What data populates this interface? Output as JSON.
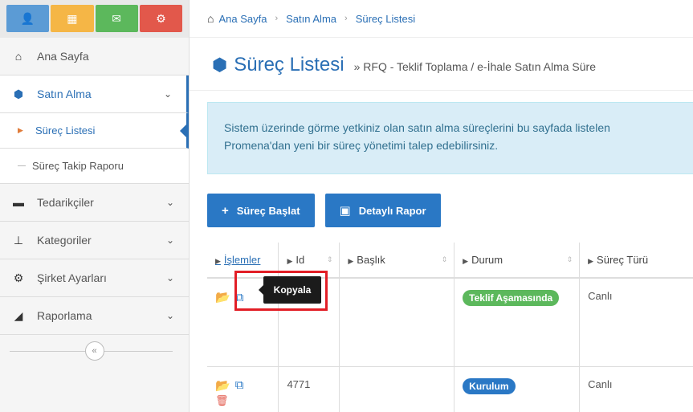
{
  "sidebar": {
    "quick_buttons": [
      {
        "icon": "user-icon",
        "glyph": "👤",
        "color": "#5b9bd5"
      },
      {
        "icon": "calendar-icon",
        "glyph": "▦",
        "color": "#f5b646"
      },
      {
        "icon": "mail-icon",
        "glyph": "✉",
        "color": "#5cb85c"
      },
      {
        "icon": "cogs-icon",
        "glyph": "⚙",
        "color": "#e2584b"
      }
    ],
    "items": [
      {
        "label": "Ana Sayfa",
        "icon": "home-icon"
      },
      {
        "label": "Satın Alma",
        "icon": "cube-icon"
      },
      {
        "label": "Tedarikçiler",
        "icon": "briefcase-icon"
      },
      {
        "label": "Kategoriler",
        "icon": "sitemap-icon"
      },
      {
        "label": "Şirket Ayarları",
        "icon": "gear-icon"
      },
      {
        "label": "Raporlama",
        "icon": "area-chart-icon"
      }
    ],
    "sub_items": [
      {
        "label": "Süreç Listesi"
      },
      {
        "label": "Süreç Takip Raporu"
      }
    ],
    "collapse_glyph": "«"
  },
  "breadcrumb": {
    "home": "Ana Sayfa",
    "level2": "Satın Alma",
    "level3": "Süreç Listesi"
  },
  "page": {
    "title": "Süreç Listesi",
    "subtitle": "» RFQ - Teklif Toplama / e-İhale Satın Alma Süre"
  },
  "info": {
    "line1": "Sistem üzerinde görme yetkiniz olan satın alma süreçlerini bu sayfada listelen",
    "line2": "Promena'dan yeni bir süreç yönetimi talep edebilirsiniz."
  },
  "buttons": {
    "start_process": "Süreç Başlat",
    "detailed_report": "Detaylı Rapor"
  },
  "table": {
    "columns": [
      "İşlemler",
      "Id",
      "Başlık",
      "Durum",
      "Süreç Türü"
    ],
    "rows": [
      {
        "id": "",
        "title": "",
        "status": "Teklif Aşamasında",
        "status_color": "#5cb85c",
        "type": "Canlı"
      },
      {
        "id": "4771",
        "title": "",
        "status": "Kurulum",
        "status_color": "#2a78c5",
        "type": "Canlı"
      }
    ]
  },
  "tooltip": {
    "text": "Kopyala"
  },
  "colors": {
    "accent": "#2a6fb5",
    "highlight": "#e21e26"
  }
}
